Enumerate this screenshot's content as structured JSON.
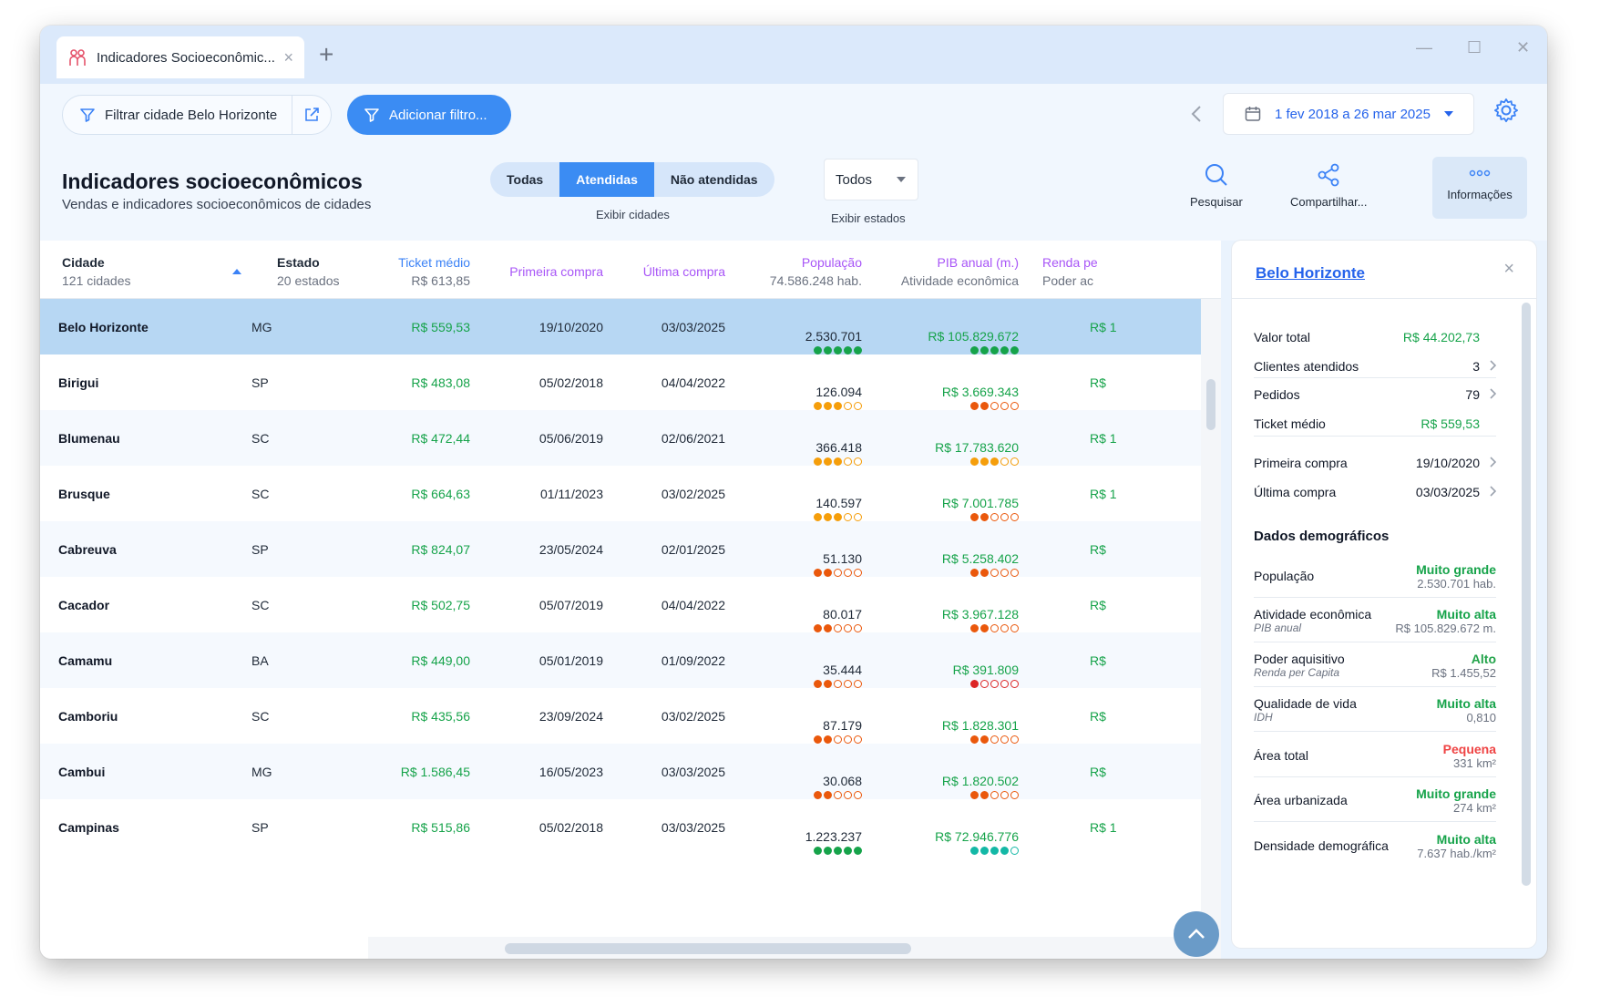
{
  "tab": {
    "title": "Indicadores Socioeconômic...",
    "close": "×",
    "new": "+"
  },
  "window_controls": {
    "minimize": "—",
    "maximize": "☐",
    "close": "✕"
  },
  "toolbar": {
    "filter_label": "Filtrar cidade Belo Horizonte",
    "add_filter_label": "Adicionar filtro...",
    "date_range": "1 fev 2018 a 26 mar 2025"
  },
  "header": {
    "title": "Indicadores socioeconômicos",
    "subtitle": "Vendas e indicadores socioeconômicos de cidades",
    "segments": [
      "Todas",
      "Atendidas",
      "Não atendidas"
    ],
    "segment_caption": "Exibir cidades",
    "states_value": "Todos",
    "states_caption": "Exibir estados",
    "actions": {
      "search": "Pesquisar",
      "share": "Compartilhar...",
      "info": "Informações"
    }
  },
  "columns": {
    "city": {
      "title": "Cidade",
      "sub": "121 cidades"
    },
    "state": {
      "title": "Estado",
      "sub": "20 estados"
    },
    "ticket": {
      "title": "Ticket médio",
      "sub": "R$ 613,85"
    },
    "first": {
      "title": "Primeira compra"
    },
    "last": {
      "title": "Última compra"
    },
    "pop": {
      "title": "População",
      "sub": "74.586.248 hab."
    },
    "pib": {
      "title": "PIB anual (m.)",
      "sub": "Atividade econômica"
    },
    "renda": {
      "title": "Renda pe",
      "sub": "Poder ac"
    }
  },
  "colors": {
    "green": "#16a34a",
    "orange": "#f59e0b",
    "deep_orange": "#ea580c",
    "red": "#dc2626",
    "teal": "#14b8a6",
    "accent": "#3b8cf3"
  },
  "rows": [
    {
      "city": "Belo Horizonte",
      "state": "MG",
      "ticket": "R$ 559,53",
      "first": "19/10/2020",
      "last": "03/03/2025",
      "pop": "2.530.701",
      "pop_level": 5,
      "pop_color": "green",
      "pib": "R$ 105.829.672",
      "pib_level": 5,
      "pib_color": "green",
      "renda": "R$ 1"
    },
    {
      "city": "Birigui",
      "state": "SP",
      "ticket": "R$ 483,08",
      "first": "05/02/2018",
      "last": "04/04/2022",
      "pop": "126.094",
      "pop_level": 3,
      "pop_color": "orange",
      "pib": "R$ 3.669.343",
      "pib_level": 2,
      "pib_color": "deep_orange",
      "renda": "R$"
    },
    {
      "city": "Blumenau",
      "state": "SC",
      "ticket": "R$ 472,44",
      "first": "05/06/2019",
      "last": "02/06/2021",
      "pop": "366.418",
      "pop_level": 3,
      "pop_color": "orange",
      "pib": "R$ 17.783.620",
      "pib_level": 3,
      "pib_color": "orange",
      "renda": "R$ 1"
    },
    {
      "city": "Brusque",
      "state": "SC",
      "ticket": "R$ 664,63",
      "first": "01/11/2023",
      "last": "03/02/2025",
      "pop": "140.597",
      "pop_level": 3,
      "pop_color": "orange",
      "pib": "R$ 7.001.785",
      "pib_level": 2,
      "pib_color": "deep_orange",
      "renda": "R$ 1"
    },
    {
      "city": "Cabreuva",
      "state": "SP",
      "ticket": "R$ 824,07",
      "first": "23/05/2024",
      "last": "02/01/2025",
      "pop": "51.130",
      "pop_level": 2,
      "pop_color": "deep_orange",
      "pib": "R$ 5.258.402",
      "pib_level": 2,
      "pib_color": "deep_orange",
      "renda": "R$"
    },
    {
      "city": "Cacador",
      "state": "SC",
      "ticket": "R$ 502,75",
      "first": "05/07/2019",
      "last": "04/04/2022",
      "pop": "80.017",
      "pop_level": 2,
      "pop_color": "deep_orange",
      "pib": "R$ 3.967.128",
      "pib_level": 2,
      "pib_color": "deep_orange",
      "renda": "R$"
    },
    {
      "city": "Camamu",
      "state": "BA",
      "ticket": "R$ 449,00",
      "first": "05/01/2019",
      "last": "01/09/2022",
      "pop": "35.444",
      "pop_level": 2,
      "pop_color": "deep_orange",
      "pib": "R$ 391.809",
      "pib_level": 1,
      "pib_color": "red",
      "renda": "R$"
    },
    {
      "city": "Camboriu",
      "state": "SC",
      "ticket": "R$ 435,56",
      "first": "23/09/2024",
      "last": "03/02/2025",
      "pop": "87.179",
      "pop_level": 2,
      "pop_color": "deep_orange",
      "pib": "R$ 1.828.301",
      "pib_level": 2,
      "pib_color": "deep_orange",
      "renda": "R$"
    },
    {
      "city": "Cambui",
      "state": "MG",
      "ticket": "R$ 1.586,45",
      "first": "16/05/2023",
      "last": "03/03/2025",
      "pop": "30.068",
      "pop_level": 2,
      "pop_color": "deep_orange",
      "pib": "R$ 1.820.502",
      "pib_level": 2,
      "pib_color": "deep_orange",
      "renda": "R$"
    },
    {
      "city": "Campinas",
      "state": "SP",
      "ticket": "R$ 515,86",
      "first": "05/02/2018",
      "last": "03/03/2025",
      "pop": "1.223.237",
      "pop_level": 5,
      "pop_color": "green",
      "pib": "R$ 72.946.776",
      "pib_level": 4,
      "pib_color": "teal",
      "renda": "R$ 1"
    }
  ],
  "panel": {
    "city": "Belo Horizonte",
    "close": "×",
    "summary": [
      {
        "label": "Valor total",
        "value": "R$ 44.202,73",
        "green": true,
        "chevron": false
      },
      {
        "label": "Clientes atendidos",
        "value": "3",
        "green": false,
        "chevron": true
      },
      {
        "label": "Pedidos",
        "value": "79",
        "green": false,
        "chevron": true
      },
      {
        "label": "Ticket médio",
        "value": "R$ 559,53",
        "green": true,
        "chevron": false
      },
      {
        "label": "Primeira compra",
        "value": "19/10/2020",
        "green": false,
        "chevron": true
      },
      {
        "label": "Última compra",
        "value": "03/03/2025",
        "green": false,
        "chevron": true
      }
    ],
    "demo_title": "Dados demográficos",
    "demo": [
      {
        "label": "População",
        "sublabel": "",
        "rating": "Muito grande",
        "rating_color": "#16a34a",
        "value": "2.530.701 hab."
      },
      {
        "label": "Atividade econômica",
        "sublabel": "PIB anual",
        "rating": "Muito alta",
        "rating_color": "#16a34a",
        "value": "R$ 105.829.672 m."
      },
      {
        "label": "Poder aquisitivo",
        "sublabel": "Renda per Capita",
        "rating": "Alto",
        "rating_color": "#22a34a",
        "value": "R$ 1.455,52"
      },
      {
        "label": "Qualidade de vida",
        "sublabel": "IDH",
        "rating": "Muito alta",
        "rating_color": "#16a34a",
        "value": "0,810"
      },
      {
        "label": "Área total",
        "sublabel": "",
        "rating": "Pequena",
        "rating_color": "#ef4444",
        "value": "331 km²"
      },
      {
        "label": "Área urbanizada",
        "sublabel": "",
        "rating": "Muito grande",
        "rating_color": "#16a34a",
        "value": "274 km²"
      },
      {
        "label": "Densidade demográfica",
        "sublabel": "",
        "rating": "Muito alta",
        "rating_color": "#16a34a",
        "value": "7.637 hab./km²"
      }
    ]
  }
}
